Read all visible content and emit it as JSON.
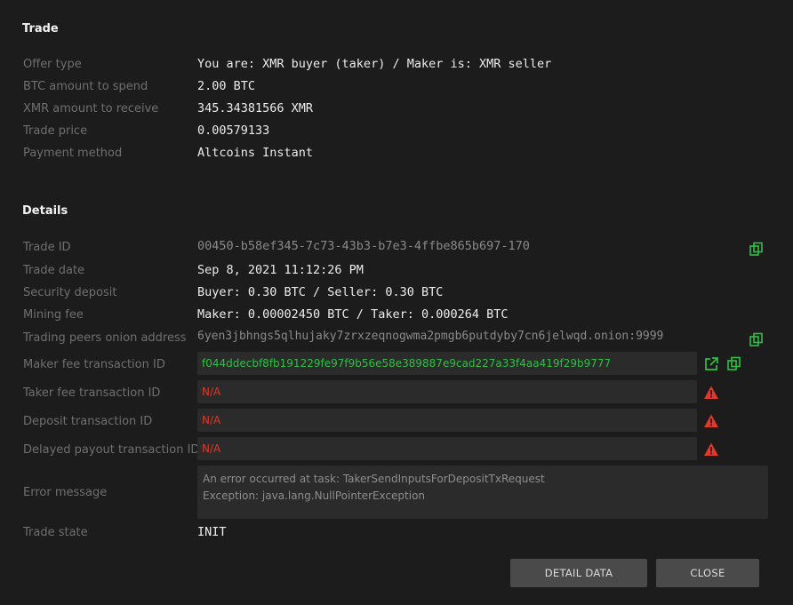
{
  "trade": {
    "title": "Trade",
    "rows": [
      {
        "label": "Offer type",
        "value": "You are: XMR buyer (taker) / Maker is: XMR seller"
      },
      {
        "label": "BTC amount to spend",
        "value": "2.00 BTC"
      },
      {
        "label": "XMR amount to receive",
        "value": "345.34381566 XMR"
      },
      {
        "label": "Trade price",
        "value": "0.00579133"
      },
      {
        "label": "Payment method",
        "value": "Altcoins Instant"
      }
    ]
  },
  "details": {
    "title": "Details",
    "trade_id": {
      "label": "Trade ID",
      "value": "00450-b58ef345-7c73-43b3-b7e3-4ffbe865b697-170"
    },
    "trade_date": {
      "label": "Trade date",
      "value": "Sep 8, 2021 11:12:26 PM"
    },
    "security_deposit": {
      "label": "Security deposit",
      "value": "Buyer: 0.30 BTC / Seller: 0.30 BTC"
    },
    "mining_fee": {
      "label": "Mining fee",
      "value": "Maker: 0.00002450 BTC / Taker: 0.000264 BTC"
    },
    "peers_onion": {
      "label": "Trading peers onion address",
      "value": "6yen3jbhngs5qlhujaky7zrxzeqnogwma2pmgb6putdyby7cn6jelwqd.onion:9999"
    },
    "maker_fee_tx": {
      "label": "Maker fee transaction ID",
      "value": "f044ddecbf8fb191229fe97f9b56e58e389887e9cad227a33f4aa419f29b9777"
    },
    "taker_fee_tx": {
      "label": "Taker fee transaction ID",
      "value": "N/A"
    },
    "deposit_tx": {
      "label": "Deposit transaction ID",
      "value": "N/A"
    },
    "delayed_payout_tx": {
      "label": "Delayed payout transaction ID",
      "value": "N/A"
    },
    "error_message": {
      "label": "Error message",
      "line1": "An error occurred at task: TakerSendInputsForDepositTxRequest",
      "line2": "Exception: java.lang.NullPointerException"
    },
    "trade_state": {
      "label": "Trade state",
      "value": "INIT"
    }
  },
  "buttons": {
    "detail_data": "DETAIL DATA",
    "close": "CLOSE"
  },
  "colors": {
    "background": "#1c1c1c",
    "field_bg": "#2b2b2b",
    "success_green": "#2fbf46",
    "error_red": "#e0392b",
    "button_bg": "#4a4a4a"
  },
  "icons": {
    "copy": "copy-icon",
    "external_link": "external-link-icon",
    "warning": "warning-icon"
  }
}
